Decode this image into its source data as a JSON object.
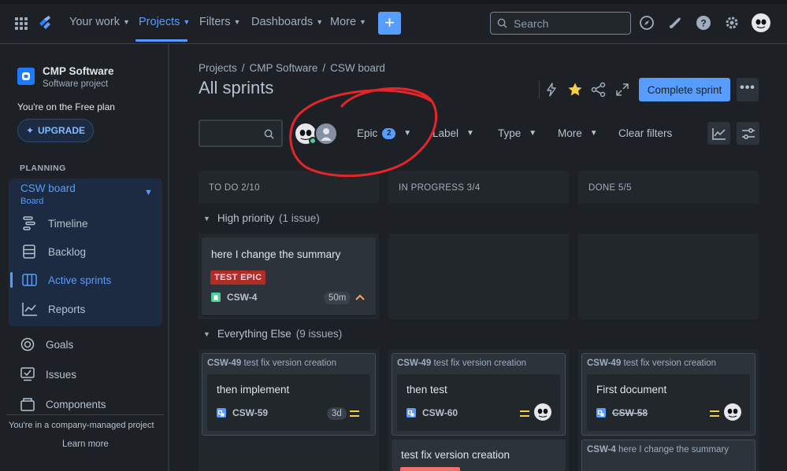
{
  "topnav": {
    "items": [
      {
        "label": "Your work"
      },
      {
        "label": "Projects"
      },
      {
        "label": "Filters"
      },
      {
        "label": "Dashboards"
      },
      {
        "label": "More"
      }
    ],
    "create_label": "+",
    "search_placeholder": "Search"
  },
  "sidebar": {
    "project_name": "CMP Software",
    "project_type": "Software project",
    "plan_text": "You're on the Free plan",
    "upgrade_label": "UPGRADE",
    "section": "PLANNING",
    "board_title": "CSW board",
    "board_sub": "Board",
    "items": [
      {
        "label": "Timeline"
      },
      {
        "label": "Backlog"
      },
      {
        "label": "Active sprints"
      },
      {
        "label": "Reports"
      },
      {
        "label": "Goals"
      },
      {
        "label": "Issues"
      },
      {
        "label": "Components"
      }
    ],
    "company_text": "You're in a company-managed project",
    "learn_more": "Learn more"
  },
  "header": {
    "breadcrumb": [
      "Projects",
      "/",
      "CMP Software",
      "/",
      "CSW board"
    ],
    "title": "All sprints",
    "complete_label": "Complete sprint",
    "more_label": "•••"
  },
  "filters": {
    "epic_label": "Epic",
    "epic_count": "2",
    "label_label": "Label",
    "type_label": "Type",
    "more_label": "More",
    "clear_label": "Clear filters"
  },
  "columns": [
    {
      "label": "TO DO 2/10"
    },
    {
      "label": "IN PROGRESS 3/4"
    },
    {
      "label": "DONE 5/5"
    }
  ],
  "swimlanes": [
    {
      "name": "High priority",
      "count": "(1 issue)"
    },
    {
      "name": "Everything Else",
      "count": "(9 issues)"
    }
  ],
  "high_card": {
    "title": "here I change the summary",
    "epic": "TEST EPIC",
    "key": "CSW-4",
    "estimate": "50m"
  },
  "cards": {
    "todo": {
      "parent_key": "CSW-49",
      "parent_title": "test fix version creation",
      "title": "then implement",
      "key": "CSW-59",
      "estimate": "3d"
    },
    "inprogress": {
      "parent_key": "CSW-49",
      "parent_title": "test fix version creation",
      "title": "then test",
      "key": "CSW-60"
    },
    "inprogress2": {
      "title": "test fix version creation"
    },
    "done": {
      "parent_key": "CSW-49",
      "parent_title": "test fix version creation",
      "title": "First document",
      "key": "CSW-58"
    },
    "done2": {
      "parent_key": "CSW-4",
      "parent_title": "here I change the summary"
    }
  },
  "colors": {
    "accent": "#579dff",
    "annotation": "#e5252a",
    "background": "#1d2125",
    "epic_lozenge": "#ae2e24"
  }
}
